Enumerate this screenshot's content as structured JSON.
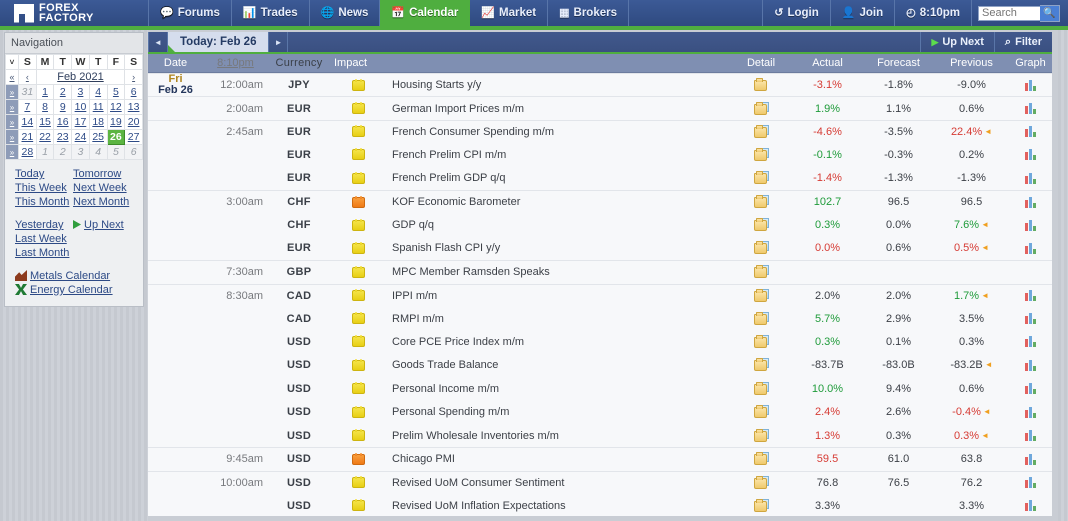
{
  "site": {
    "brand_line1": "FOREX",
    "brand_line2": "FACTORY",
    "accent_green": "#4fae3f",
    "nav_blue": "#3c5a96"
  },
  "topnav": {
    "tabs": [
      {
        "label": "Forums",
        "icon": "speech-bubble-icon",
        "active": false
      },
      {
        "label": "Trades",
        "icon": "bar-chart-icon",
        "active": false
      },
      {
        "label": "News",
        "icon": "globe-icon",
        "active": false
      },
      {
        "label": "Calendar",
        "icon": "calendar-icon",
        "active": true
      },
      {
        "label": "Market",
        "icon": "line-chart-icon",
        "active": false
      },
      {
        "label": "Brokers",
        "icon": "grid-icon",
        "active": false
      }
    ],
    "login": "Login",
    "join": "Join",
    "clock": "8:10pm",
    "search_placeholder": "Search",
    "search_value": ""
  },
  "sidebar": {
    "panel_title": "Navigation",
    "calendar": {
      "month_label": "Feb 2021",
      "prev_year": "«",
      "prev_month": "‹",
      "next_month": "›",
      "dow": [
        "S",
        "M",
        "T",
        "W",
        "T",
        "F",
        "S"
      ],
      "weeks": [
        {
          "marker": "»",
          "days": [
            {
              "n": "31",
              "off": true
            },
            {
              "n": "1"
            },
            {
              "n": "2"
            },
            {
              "n": "3"
            },
            {
              "n": "4"
            },
            {
              "n": "5"
            },
            {
              "n": "6"
            }
          ]
        },
        {
          "marker": "»",
          "days": [
            {
              "n": "7"
            },
            {
              "n": "8"
            },
            {
              "n": "9"
            },
            {
              "n": "10"
            },
            {
              "n": "11"
            },
            {
              "n": "12"
            },
            {
              "n": "13"
            }
          ]
        },
        {
          "marker": "»",
          "days": [
            {
              "n": "14"
            },
            {
              "n": "15"
            },
            {
              "n": "16"
            },
            {
              "n": "17"
            },
            {
              "n": "18"
            },
            {
              "n": "19"
            },
            {
              "n": "20"
            }
          ]
        },
        {
          "marker": "»",
          "days": [
            {
              "n": "21"
            },
            {
              "n": "22"
            },
            {
              "n": "23"
            },
            {
              "n": "24"
            },
            {
              "n": "25"
            },
            {
              "n": "26",
              "today": true
            },
            {
              "n": "27"
            }
          ]
        },
        {
          "marker": "»",
          "days": [
            {
              "n": "28"
            },
            {
              "n": "1",
              "off": true
            },
            {
              "n": "2",
              "off": true
            },
            {
              "n": "3",
              "off": true
            },
            {
              "n": "4",
              "off": true
            },
            {
              "n": "5",
              "off": true
            },
            {
              "n": "6",
              "off": true
            }
          ]
        }
      ],
      "header_marker": "˅"
    },
    "links": {
      "row1": [
        "Today",
        "Tomorrow"
      ],
      "row2": [
        "This Week",
        "Next Week"
      ],
      "row3": [
        "This Month",
        "Next Month"
      ],
      "row4": [
        "Yesterday",
        "Up Next"
      ],
      "row5": [
        "Last Week"
      ],
      "row6": [
        "Last Month"
      ],
      "metals": "Metals Calendar",
      "energy": "Energy Calendar"
    }
  },
  "toolbar": {
    "prev_arrow": "◄",
    "next_arrow": "►",
    "today_label": "Today: Feb 26",
    "up_next": "Up Next",
    "filter": "Filter",
    "filter_icon": "funnel-icon"
  },
  "table": {
    "headers": {
      "date": "Date",
      "time": "8:10pm",
      "currency": "Currency",
      "impact": "Impact",
      "detail": "Detail",
      "actual": "Actual",
      "forecast": "Forecast",
      "previous": "Previous",
      "graph": "Graph"
    },
    "day": {
      "dow": "Fri",
      "date": "Feb 26"
    },
    "rows": [
      {
        "time": "12:00am",
        "currency": "JPY",
        "impact": "low",
        "event": "Housing Starts y/y",
        "detail_icon": "folder-icon",
        "actual": "-3.1%",
        "actual_state": "worse",
        "forecast": "-1.8%",
        "previous": "-9.0%",
        "previous_state": "plain",
        "revised": false,
        "graph": true,
        "sep": true,
        "first": true
      },
      {
        "time": "2:00am",
        "currency": "EUR",
        "impact": "low",
        "event": "German Import Prices m/m",
        "detail_icon": "folder-doc-icon",
        "actual": "1.9%",
        "actual_state": "better",
        "forecast": "1.1%",
        "previous": "0.6%",
        "previous_state": "plain",
        "revised": false,
        "graph": true,
        "sep": true
      },
      {
        "time": "2:45am",
        "currency": "EUR",
        "impact": "low",
        "event": "French Consumer Spending m/m",
        "detail_icon": "folder-doc-icon",
        "actual": "-4.6%",
        "actual_state": "worse",
        "forecast": "-3.5%",
        "previous": "22.4%",
        "previous_state": "worse",
        "revised": true,
        "graph": true,
        "sep": true
      },
      {
        "time": "",
        "currency": "EUR",
        "impact": "low",
        "event": "French Prelim CPI m/m",
        "detail_icon": "folder-doc-icon",
        "actual": "-0.1%",
        "actual_state": "better",
        "forecast": "-0.3%",
        "previous": "0.2%",
        "previous_state": "plain",
        "revised": false,
        "graph": true,
        "sep": false
      },
      {
        "time": "",
        "currency": "EUR",
        "impact": "low",
        "event": "French Prelim GDP q/q",
        "detail_icon": "folder-doc-icon",
        "actual": "-1.4%",
        "actual_state": "worse",
        "forecast": "-1.3%",
        "previous": "-1.3%",
        "previous_state": "plain",
        "revised": false,
        "graph": true,
        "sep": false
      },
      {
        "time": "3:00am",
        "currency": "CHF",
        "impact": "med",
        "event": "KOF Economic Barometer",
        "detail_icon": "folder-doc-icon",
        "actual": "102.7",
        "actual_state": "better",
        "forecast": "96.5",
        "previous": "96.5",
        "previous_state": "plain",
        "revised": false,
        "graph": true,
        "sep": true
      },
      {
        "time": "",
        "currency": "CHF",
        "impact": "low",
        "event": "GDP q/q",
        "detail_icon": "folder-doc-icon",
        "actual": "0.3%",
        "actual_state": "better",
        "forecast": "0.0%",
        "previous": "7.6%",
        "previous_state": "better",
        "revised": true,
        "graph": true,
        "sep": false
      },
      {
        "time": "",
        "currency": "EUR",
        "impact": "low",
        "event": "Spanish Flash CPI y/y",
        "detail_icon": "folder-doc-icon",
        "actual": "0.0%",
        "actual_state": "worse",
        "forecast": "0.6%",
        "previous": "0.5%",
        "previous_state": "worse",
        "revised": true,
        "graph": true,
        "sep": false
      },
      {
        "time": "7:30am",
        "currency": "GBP",
        "impact": "low",
        "event": "MPC Member Ramsden Speaks",
        "detail_icon": "folder-doc-icon",
        "actual": "",
        "actual_state": "plain",
        "forecast": "",
        "previous": "",
        "previous_state": "plain",
        "revised": false,
        "graph": false,
        "sep": true
      },
      {
        "time": "8:30am",
        "currency": "CAD",
        "impact": "low",
        "event": "IPPI m/m",
        "detail_icon": "folder-doc-icon",
        "actual": "2.0%",
        "actual_state": "plain",
        "forecast": "2.0%",
        "previous": "1.7%",
        "previous_state": "better",
        "revised": true,
        "graph": true,
        "sep": true
      },
      {
        "time": "",
        "currency": "CAD",
        "impact": "low",
        "event": "RMPI m/m",
        "detail_icon": "folder-doc-icon",
        "actual": "5.7%",
        "actual_state": "better",
        "forecast": "2.9%",
        "previous": "3.5%",
        "previous_state": "plain",
        "revised": false,
        "graph": true,
        "sep": false
      },
      {
        "time": "",
        "currency": "USD",
        "impact": "low",
        "event": "Core PCE Price Index m/m",
        "detail_icon": "folder-doc-icon",
        "actual": "0.3%",
        "actual_state": "better",
        "forecast": "0.1%",
        "previous": "0.3%",
        "previous_state": "plain",
        "revised": false,
        "graph": true,
        "sep": false
      },
      {
        "time": "",
        "currency": "USD",
        "impact": "low",
        "event": "Goods Trade Balance",
        "detail_icon": "folder-doc-icon",
        "actual": "-83.7B",
        "actual_state": "plain",
        "forecast": "-83.0B",
        "previous": "-83.2B",
        "previous_state": "plain",
        "revised": true,
        "graph": true,
        "sep": false
      },
      {
        "time": "",
        "currency": "USD",
        "impact": "low",
        "event": "Personal Income m/m",
        "detail_icon": "folder-doc-icon",
        "actual": "10.0%",
        "actual_state": "better",
        "forecast": "9.4%",
        "previous": "0.6%",
        "previous_state": "plain",
        "revised": false,
        "graph": true,
        "sep": false
      },
      {
        "time": "",
        "currency": "USD",
        "impact": "low",
        "event": "Personal Spending m/m",
        "detail_icon": "folder-doc-icon",
        "actual": "2.4%",
        "actual_state": "worse",
        "forecast": "2.6%",
        "previous": "-0.4%",
        "previous_state": "worse",
        "revised": true,
        "graph": true,
        "sep": false
      },
      {
        "time": "",
        "currency": "USD",
        "impact": "low",
        "event": "Prelim Wholesale Inventories m/m",
        "detail_icon": "folder-doc-icon",
        "actual": "1.3%",
        "actual_state": "worse",
        "forecast": "0.3%",
        "previous": "0.3%",
        "previous_state": "worse",
        "revised": true,
        "graph": true,
        "sep": false
      },
      {
        "time": "9:45am",
        "currency": "USD",
        "impact": "med",
        "event": "Chicago PMI",
        "detail_icon": "folder-doc-icon",
        "actual": "59.5",
        "actual_state": "worse",
        "forecast": "61.0",
        "previous": "63.8",
        "previous_state": "plain",
        "revised": false,
        "graph": true,
        "sep": true
      },
      {
        "time": "10:00am",
        "currency": "USD",
        "impact": "low",
        "event": "Revised UoM Consumer Sentiment",
        "detail_icon": "folder-doc-icon",
        "actual": "76.8",
        "actual_state": "plain",
        "forecast": "76.5",
        "previous": "76.2",
        "previous_state": "plain",
        "revised": false,
        "graph": true,
        "sep": true
      },
      {
        "time": "",
        "currency": "USD",
        "impact": "low",
        "event": "Revised UoM Inflation Expectations",
        "detail_icon": "folder-doc-icon",
        "actual": "3.3%",
        "actual_state": "plain",
        "forecast": "",
        "previous": "3.3%",
        "previous_state": "plain",
        "revised": false,
        "graph": true,
        "sep": false
      }
    ]
  }
}
